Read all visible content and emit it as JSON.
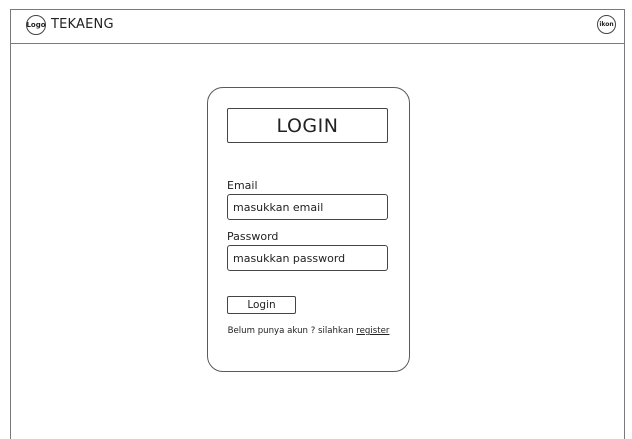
{
  "header": {
    "logo_label": "Logo",
    "brand": "TEKAENG",
    "profile_icon_label": "ikon"
  },
  "login_card": {
    "title": "LOGIN",
    "email_label": "Email",
    "email_placeholder": "masukkan email",
    "password_label": "Password",
    "password_placeholder": "masukkan password",
    "submit_label": "Login",
    "register_prompt": "Belum punya akun ? silahkan ",
    "register_link": "register"
  }
}
